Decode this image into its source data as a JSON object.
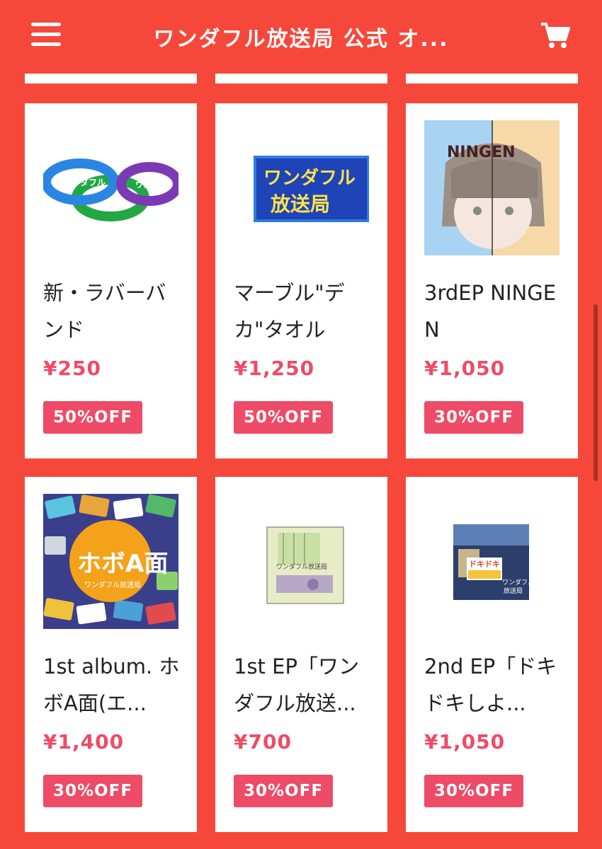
{
  "header": {
    "title": "ワンダフル放送局 公式 オ...",
    "menu_icon": "hamburger-menu-icon",
    "cart_icon": "shopping-cart-icon"
  },
  "colors": {
    "background": "#f5483b",
    "price": "#ee4b66",
    "badge": "#ee4b66",
    "card": "#ffffff"
  },
  "products": [
    {
      "name": "新・ラバーバンド",
      "price": "¥250",
      "discount": "50%OFF"
    },
    {
      "name": "マーブル\"デカ\"タオル",
      "price": "¥1,250",
      "discount": "50%OFF"
    },
    {
      "name": "3rdEP NINGEN",
      "price": "¥1,050",
      "discount": "30%OFF",
      "image_text": "NINGEN"
    },
    {
      "name": "1st album. ホボA面(エ...",
      "price": "¥1,400",
      "discount": "30%OFF"
    },
    {
      "name": "1st EP「ワンダフル放送...",
      "price": "¥700",
      "discount": "30%OFF"
    },
    {
      "name": "2nd EP「ドキドキしよ...",
      "price": "¥1,050",
      "discount": "30%OFF"
    }
  ]
}
